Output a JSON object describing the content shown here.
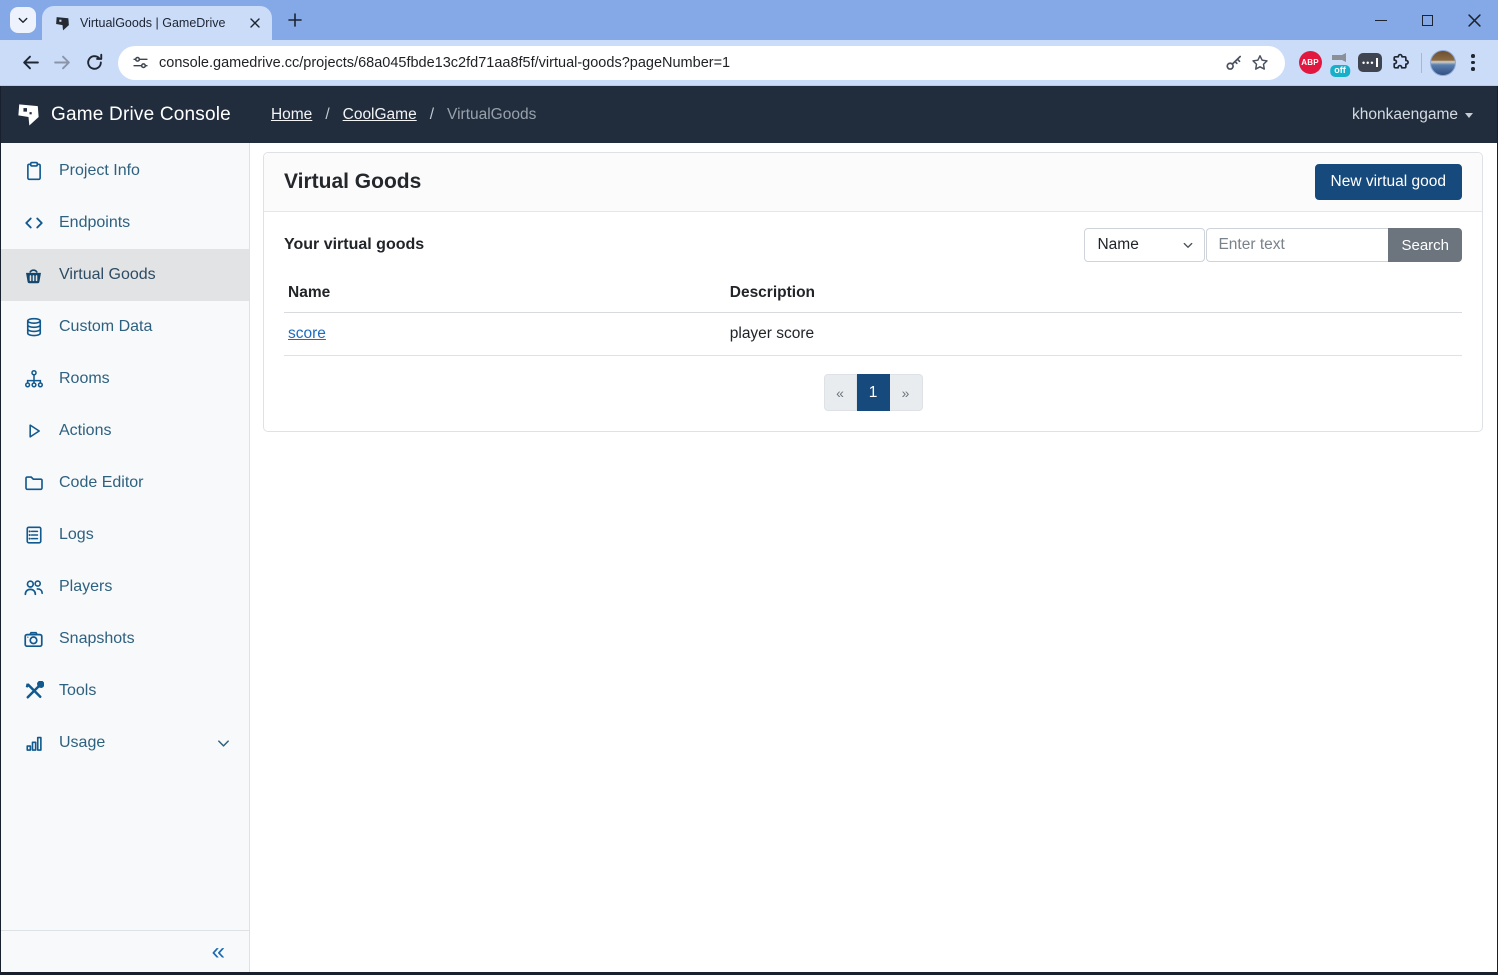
{
  "browser": {
    "tab_title": "VirtualGoods | GameDrive",
    "url": "console.gamedrive.cc/projects/68a045fbde13c2fd71aa8f5f/virtual-goods?pageNumber=1",
    "extensions": {
      "adblock_label": "ABP",
      "cam_badge": "off"
    }
  },
  "navbar": {
    "brand": "Game Drive Console",
    "separator": "/",
    "breadcrumbs": {
      "home": "Home",
      "project": "CoolGame",
      "current": "VirtualGoods"
    },
    "user": "khonkaengame"
  },
  "sidebar": {
    "items": [
      {
        "label": "Project Info",
        "icon": "clipboard-icon"
      },
      {
        "label": "Endpoints",
        "icon": "code-icon"
      },
      {
        "label": "Virtual Goods",
        "icon": "basket-icon",
        "active": true
      },
      {
        "label": "Custom Data",
        "icon": "database-icon"
      },
      {
        "label": "Rooms",
        "icon": "sitemap-icon"
      },
      {
        "label": "Actions",
        "icon": "play-icon"
      },
      {
        "label": "Code Editor",
        "icon": "folder-icon"
      },
      {
        "label": "Logs",
        "icon": "journal-icon"
      },
      {
        "label": "Players",
        "icon": "people-icon"
      },
      {
        "label": "Snapshots",
        "icon": "camera-icon"
      },
      {
        "label": "Tools",
        "icon": "tools-icon"
      },
      {
        "label": "Usage",
        "icon": "bar-chart-icon",
        "expandable": true
      }
    ],
    "collapse": "«"
  },
  "main": {
    "title": "Virtual Goods",
    "new_button": "New virtual good",
    "heading": "Your virtual goods",
    "search": {
      "field": "Name",
      "placeholder": "Enter text",
      "button": "Search"
    },
    "table": {
      "headers": [
        "Name",
        "Description"
      ],
      "rows": [
        {
          "name": "score",
          "description": "player score"
        }
      ]
    },
    "pagination": {
      "prev": "«",
      "page": "1",
      "next": "»"
    }
  },
  "colors": {
    "accent": "#164a7c",
    "navbar_bg": "#212d3d",
    "sidebar_icon": "#11598e",
    "link": "#1b6ec2",
    "frame_blue": "#85a9e7",
    "toolbar_blue": "#cbdcf8",
    "search_button": "#6c757d"
  }
}
